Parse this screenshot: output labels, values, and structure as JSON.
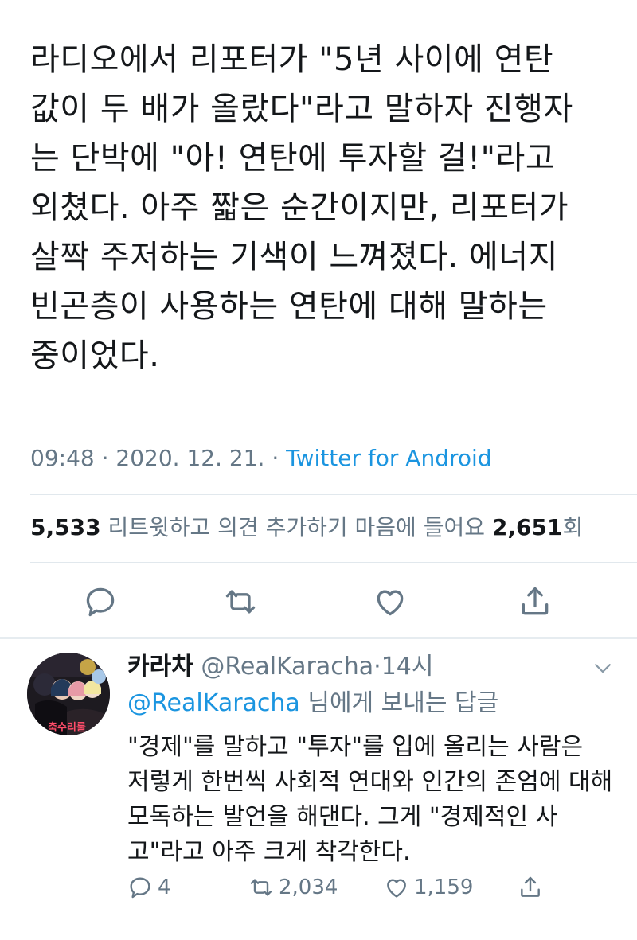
{
  "tweet": {
    "lines": [
      "라디오에서 리포터가 \"5년 사이에 연탄",
      "값이 두 배가 올랐다\"라고 말하자 진행자",
      "는 단박에 \"아! 연탄에 투자할 걸!\"라고",
      "외쳤다. 아주 짧은 순간이지만, 리포터가",
      "살짝 주저하는 기색이 느껴졌다. 에너지",
      "빈곤층이 사용하는 연탄에 대해 말하는",
      "중이었다."
    ],
    "time": "09:48",
    "date": "2020. 12. 21.",
    "separator": " · ",
    "source": "Twitter for Android",
    "retweet_count": "5,533",
    "retweet_label": " 리트윗하고 의견 추가하기  마음에 들어요 ",
    "like_count": "2,651",
    "like_suffix": "회"
  },
  "reply": {
    "display_name": "카라차",
    "handle": "@RealKaracha",
    "age": "14시",
    "reply_to_handle": "@RealKaracha",
    "reply_to_suffix": " 님에게 보내는 답글",
    "lines": [
      "\"경제\"를 말하고 \"투자\"를 입에 올리는 사람은",
      "저렇게 한번씩 사회적 연대와 인간의 존엄에 대해",
      "모독하는 발언을 해댄다. 그게 \"경제적인 사",
      "고\"라고 아주 크게 착각한다."
    ],
    "reply_count": "4",
    "retweet_count": "2,034",
    "like_count": "1,159",
    "avatar_stamp": "축수리룰"
  },
  "colors": {
    "text": "#14171a",
    "secondary": "#657786",
    "link": "#1b95e0",
    "divider": "#e1e8ed"
  },
  "icons": [
    "reply-icon",
    "retweet-icon",
    "like-icon",
    "share-icon",
    "chevron-down-icon"
  ]
}
